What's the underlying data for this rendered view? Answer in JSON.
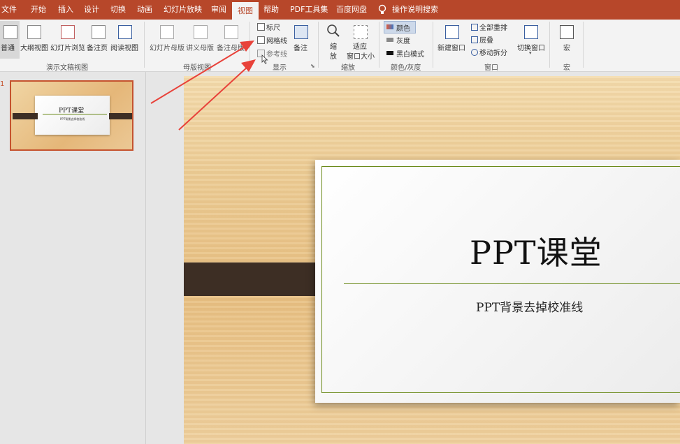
{
  "menu": {
    "items": [
      "文件",
      "开始",
      "插入",
      "设计",
      "切换",
      "动画",
      "幻灯片放映",
      "审阅",
      "视图",
      "帮助",
      "PDF工具集",
      "百度网盘",
      "操作说明搜索"
    ],
    "active": "视图"
  },
  "ribbon": {
    "presentation_views": {
      "label": "演示文稿视图",
      "buttons": [
        "普通",
        "大纲视图",
        "幻灯片浏览",
        "备注页",
        "阅读视图"
      ]
    },
    "master_views": {
      "label": "母版视图",
      "buttons": [
        "幻灯片母版",
        "讲义母版",
        "备注母版"
      ]
    },
    "show": {
      "label": "显示",
      "checkboxes": [
        "标尺",
        "网格线",
        "参考线"
      ],
      "notes": "备注"
    },
    "zoom": {
      "label": "缩放",
      "zoom_line1": "缩",
      "zoom_line2": "放",
      "fit_line1": "适应",
      "fit_line2": "窗口大小"
    },
    "color": {
      "label": "颜色/灰度",
      "items": [
        "颜色",
        "灰度",
        "黑白模式"
      ]
    },
    "window": {
      "label": "窗口",
      "new_window": "新建窗口",
      "arrange_all": "全部重排",
      "cascade": "层叠",
      "move_split": "移动拆分",
      "switch_window": "切换窗口"
    },
    "macros": {
      "label": "宏",
      "button": "宏"
    }
  },
  "thumbnail": {
    "index": "1",
    "title": "PPT课堂",
    "subtitle": "PPT背景去掉校准线"
  },
  "slide": {
    "title": "PPT课堂",
    "subtitle": "PPT背景去掉校准线"
  },
  "colors": {
    "menubar": "#b7472a",
    "ribbon": "#f3f3f3",
    "arrow": "#e8423a",
    "accent_line": "#6a8a1a"
  }
}
